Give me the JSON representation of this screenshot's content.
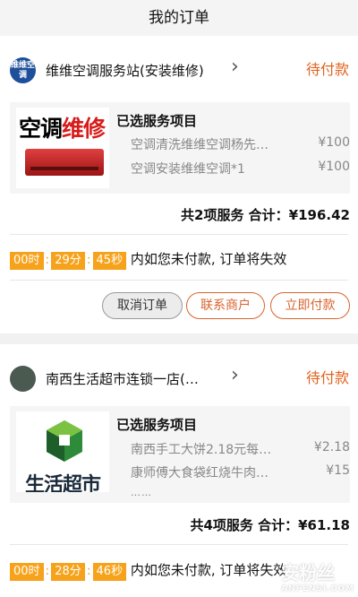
{
  "nav": {
    "title": "我的订单"
  },
  "colors": {
    "accent": "#e0631f",
    "timer_bg": "#f7a21b"
  },
  "orders": [
    {
      "shop_logo_text": "维维空调",
      "shop_name": "维维空调服务站(安装维修)",
      "status": "待付款",
      "thumb_text": {
        "black": "空调",
        "red": "维修"
      },
      "section_title": "已选服务项目",
      "items": [
        {
          "name": "空调清洗维维空调杨先…",
          "price": "¥100"
        },
        {
          "name": "空调安装维维空调*1",
          "price": "¥100"
        }
      ],
      "summary": "共2项服务 合计：¥196.42",
      "countdown": {
        "hours": "00时",
        "minutes": "29分",
        "seconds": "45秒",
        "message": "内如您未付款, 订单将失效"
      },
      "actions": {
        "cancel": "取消订单",
        "contact": "联系商户",
        "pay": "立即付款"
      }
    },
    {
      "shop_name": "南西生活超市连锁一店(…",
      "status": "待付款",
      "thumb_text": "生活超市",
      "section_title": "已选服务项目",
      "items": [
        {
          "name": "南西手工大饼2.18元每…",
          "price": "¥2.18"
        },
        {
          "name": "康师傅大食袋红烧牛肉…",
          "price": "¥15"
        }
      ],
      "more": "……",
      "summary": "共4项服务 合计：¥61.18",
      "countdown": {
        "hours": "00时",
        "minutes": "28分",
        "seconds": "46秒",
        "message": "内如您未付款, 订单将失效"
      }
    }
  ],
  "watermark": {
    "main": "安粉丝",
    "sub": "ANFENSI.COM"
  }
}
